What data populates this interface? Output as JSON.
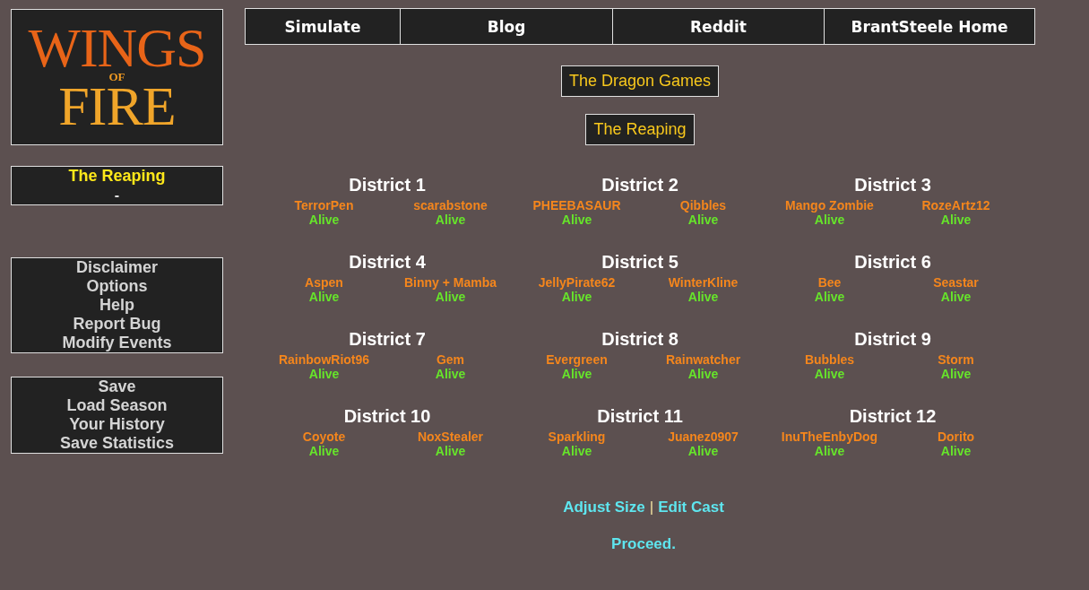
{
  "logo": {
    "lines": [
      "WINGS",
      "OF",
      "FIRE"
    ]
  },
  "status_panel": {
    "title": "The Reaping",
    "subtitle": "-"
  },
  "menus": [
    {
      "items": [
        "Disclaimer",
        "Options",
        "Help",
        "Report Bug",
        "Modify Events"
      ]
    },
    {
      "items": [
        "Save",
        "Load Season",
        "Your History",
        "Save Statistics"
      ]
    }
  ],
  "nav": {
    "items": [
      "Simulate",
      "Blog",
      "Reddit",
      "BrantSteele Home"
    ]
  },
  "season_title": "The Dragon Games",
  "phase_title": "The Reaping",
  "districts": [
    {
      "name": "District 1",
      "tributes": [
        {
          "name": "TerrorPen",
          "status": "Alive"
        },
        {
          "name": "scarabstone",
          "status": "Alive"
        }
      ]
    },
    {
      "name": "District 2",
      "tributes": [
        {
          "name": "PHEEBASAUR",
          "status": "Alive"
        },
        {
          "name": "Qibbles",
          "status": "Alive"
        }
      ]
    },
    {
      "name": "District 3",
      "tributes": [
        {
          "name": "Mango Zombie",
          "status": "Alive"
        },
        {
          "name": "RozeArtz12",
          "status": "Alive"
        }
      ]
    },
    {
      "name": "District 4",
      "tributes": [
        {
          "name": "Aspen",
          "status": "Alive"
        },
        {
          "name": "Binny + Mamba",
          "status": "Alive"
        }
      ]
    },
    {
      "name": "District 5",
      "tributes": [
        {
          "name": "JellyPirate62",
          "status": "Alive"
        },
        {
          "name": "WinterKline",
          "status": "Alive"
        }
      ]
    },
    {
      "name": "District 6",
      "tributes": [
        {
          "name": "Bee",
          "status": "Alive"
        },
        {
          "name": "Seastar",
          "status": "Alive"
        }
      ]
    },
    {
      "name": "District 7",
      "tributes": [
        {
          "name": "RainbowRiot96",
          "status": "Alive"
        },
        {
          "name": "Gem",
          "status": "Alive"
        }
      ]
    },
    {
      "name": "District 8",
      "tributes": [
        {
          "name": "Evergreen",
          "status": "Alive"
        },
        {
          "name": "Rainwatcher",
          "status": "Alive"
        }
      ]
    },
    {
      "name": "District 9",
      "tributes": [
        {
          "name": "Bubbles",
          "status": "Alive"
        },
        {
          "name": "Storm",
          "status": "Alive"
        }
      ]
    },
    {
      "name": "District 10",
      "tributes": [
        {
          "name": "Coyote",
          "status": "Alive"
        },
        {
          "name": "NoxStealer",
          "status": "Alive"
        }
      ]
    },
    {
      "name": "District 11",
      "tributes": [
        {
          "name": "Sparkling",
          "status": "Alive"
        },
        {
          "name": "Juanez0907",
          "status": "Alive"
        }
      ]
    },
    {
      "name": "District 12",
      "tributes": [
        {
          "name": "InuTheEnbyDog",
          "status": "Alive"
        },
        {
          "name": "Dorito",
          "status": "Alive"
        }
      ]
    }
  ],
  "footer": {
    "links": [
      "Adjust Size",
      "Edit Cast"
    ],
    "separator": "|",
    "proceed": "Proceed."
  }
}
